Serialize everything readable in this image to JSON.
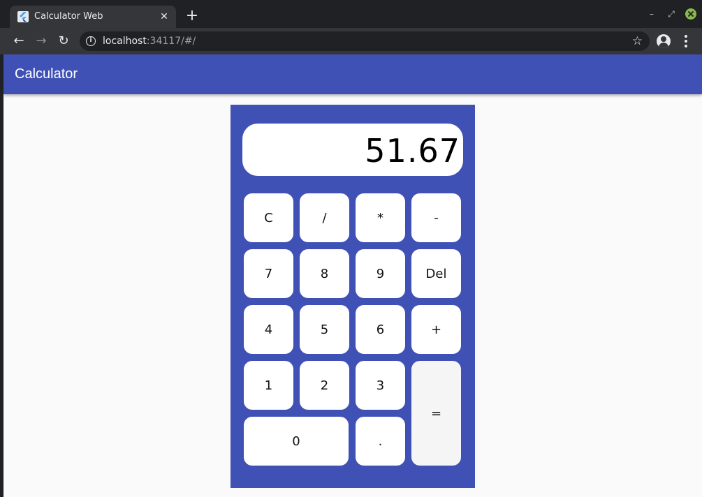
{
  "browser": {
    "tab_title": "Calculator Web",
    "tab_close": "✕",
    "new_tab": "+",
    "url_host": "localhost",
    "url_rest": ":34117/#/",
    "star": "☆",
    "back": "←",
    "forward": "→",
    "reload": "↻",
    "minimize": "–",
    "restore": "⤢"
  },
  "app": {
    "title": "Calculator",
    "display": "51.67",
    "keys": {
      "clear": "C",
      "divide": "/",
      "multiply": "*",
      "subtract": "-",
      "seven": "7",
      "eight": "8",
      "nine": "9",
      "delete": "Del",
      "four": "4",
      "five": "5",
      "six": "6",
      "add": "+",
      "one": "1",
      "two": "2",
      "three": "3",
      "equals": "=",
      "zero": "0",
      "decimal": "."
    }
  },
  "colors": {
    "primary": "#3f51b5",
    "key_background": "#ffffff",
    "equals_background": "#f5f5f5",
    "page_background": "#fafafa"
  }
}
